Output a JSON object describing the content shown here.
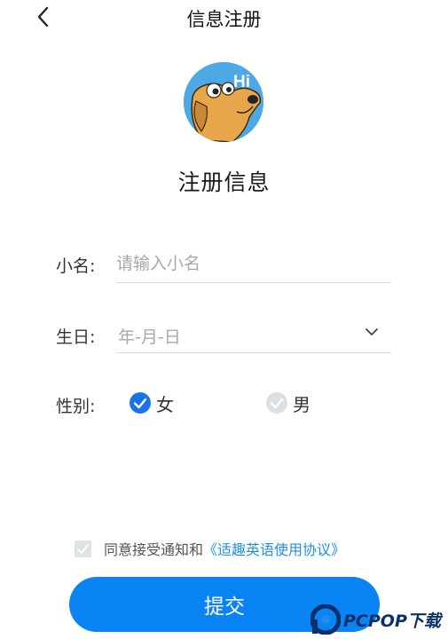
{
  "header": {
    "title": "信息注册",
    "back_icon": "chevron-left-icon"
  },
  "avatar": {
    "badge_text": "Hi",
    "bg_color": "#4ea8e6"
  },
  "form": {
    "heading": "注册信息",
    "name_label": "小名:",
    "name_placeholder": "请输入小名",
    "birthday_label": "生日:",
    "birthday_value": "年-月-日",
    "gender_label": "性别:",
    "gender_options": [
      {
        "label": "女",
        "selected": true
      },
      {
        "label": "男",
        "selected": false
      }
    ]
  },
  "agreement": {
    "text": "同意接受通知和",
    "link": "《适趣英语使用协议》",
    "checked": false
  },
  "submit_label": "提交",
  "watermark": {
    "brand": "PCPOP下载"
  },
  "colors": {
    "accent": "#0a84f5",
    "link": "#1f8fe6"
  }
}
